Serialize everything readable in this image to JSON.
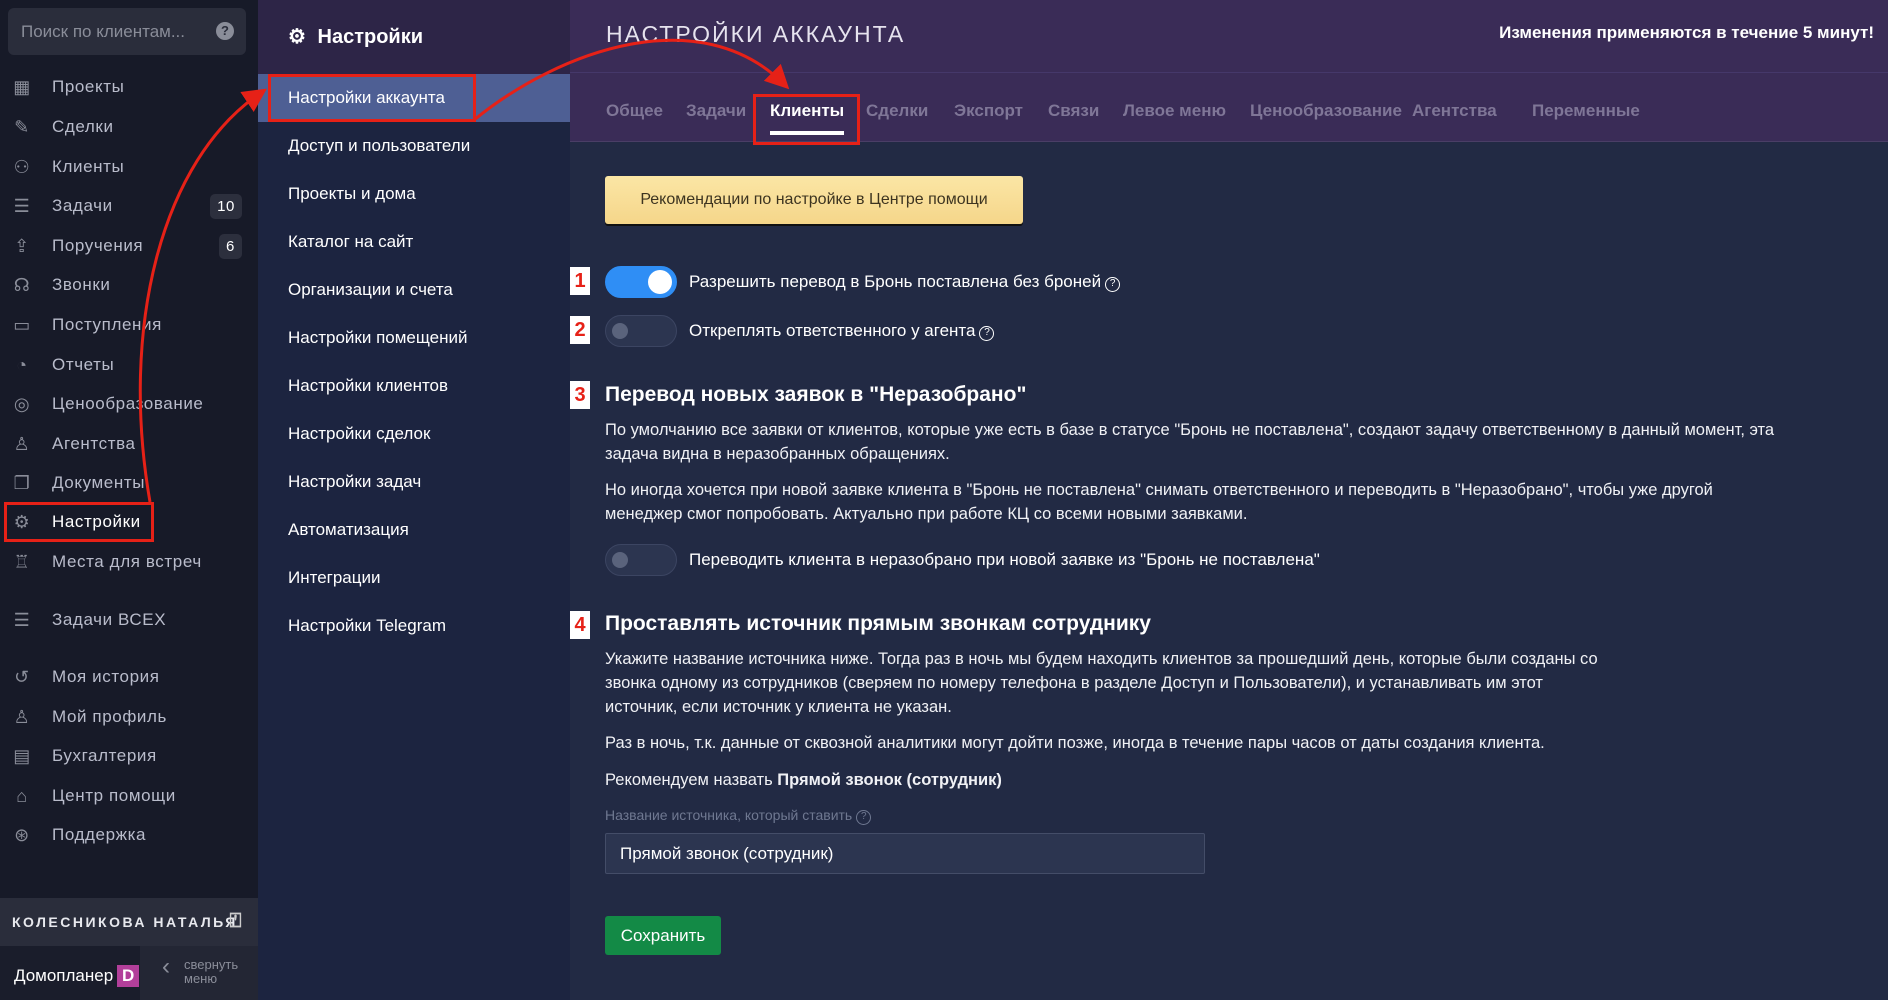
{
  "nav": {
    "search_placeholder": "Поиск по клиентам...",
    "help": "?",
    "items": [
      {
        "label": "Проекты",
        "icon": "building-icon"
      },
      {
        "label": "Сделки",
        "icon": "deal-icon"
      },
      {
        "label": "Клиенты",
        "icon": "users-icon"
      },
      {
        "label": "Задачи",
        "icon": "tasks-icon",
        "badge": "10"
      },
      {
        "label": "Поручения",
        "icon": "upload-icon",
        "badge": "6"
      },
      {
        "label": "Звонки",
        "icon": "headset-icon"
      },
      {
        "label": "Поступления",
        "icon": "wallet-icon"
      },
      {
        "label": "Отчеты",
        "icon": "pie-icon"
      },
      {
        "label": "Ценообразование",
        "icon": "coins-icon"
      },
      {
        "label": "Агентства",
        "icon": "agent-icon"
      },
      {
        "label": "Документы",
        "icon": "documents-icon"
      },
      {
        "label": "Настройки",
        "icon": "gear-icon"
      },
      {
        "label": "Места для встреч",
        "icon": "chair-icon"
      },
      {
        "label": "Задачи ВСЕХ",
        "icon": "tasks-icon"
      },
      {
        "label": "Моя история",
        "icon": "history-icon"
      },
      {
        "label": "Мой профиль",
        "icon": "profile-icon"
      },
      {
        "label": "Бухгалтерия",
        "icon": "card-icon"
      },
      {
        "label": "Центр помощи",
        "icon": "graduation-icon"
      },
      {
        "label": "Поддержка",
        "icon": "lifebuoy-icon"
      }
    ],
    "user": "КОЛЕСНИКОВА НАТАЛЬЯ",
    "brand": "Домопланер",
    "brand_logo": "D",
    "collapse": "свернуть меню"
  },
  "settings": {
    "title": "Настройки",
    "items": [
      "Настройки аккаунта",
      "Доступ и пользователи",
      "Проекты и дома",
      "Каталог на сайт",
      "Организации и счета",
      "Настройки помещений",
      "Настройки клиентов",
      "Настройки сделок",
      "Настройки задач",
      "Автоматизация",
      "Интеграции",
      "Настройки Telegram"
    ]
  },
  "main": {
    "title": "НАСТРОЙКИ АККАУНТА",
    "notice": "Изменения применяются в течение 5 минут!",
    "tabs": [
      "Общее",
      "Задачи",
      "Клиенты",
      "Сделки",
      "Экспорт",
      "Связи",
      "Левое меню",
      "Ценообразование",
      "Агентства",
      "Переменные"
    ],
    "help_button": "Рекомендации по настройке в Центре помощи",
    "annotations": [
      "1",
      "2",
      "3",
      "4"
    ],
    "toggle1": {
      "label": "Разрешить перевод в Бронь поставлена без броней",
      "on": true
    },
    "toggle2": {
      "label": "Откреплять ответственного у агента",
      "on": false
    },
    "s3": {
      "heading": "Перевод новых заявок в \"Неразобрано\"",
      "p1": "По умолчанию все заявки от клиентов, которые уже есть в базе в статусе \"Бронь не поставлена\", создают задачу ответственному в данный момент, эта задача видна в неразобранных обращениях.",
      "p2": "Но иногда хочется при новой заявке клиента в \"Бронь не поставлена\" снимать ответственного и переводить в \"Неразобрано\", чтобы уже другой менеджер смог попробовать. Актуально при работе КЦ со всеми новыми заявками.",
      "toggle": "Переводить клиента в неразобрано при новой заявке из \"Бронь не поставлена\"",
      "on": false
    },
    "s4": {
      "heading": "Проставлять источник прямым звонкам сотруднику",
      "p1": "Укажите название источника ниже. Тогда раз в ночь мы будем находить клиентов за прошедший день, которые были созданы со звонка одному из сотрудников (сверяем по номеру телефона в разделе Доступ и Пользователи), и устанавливать им этот источник, если источник у клиента не указан.",
      "p2": "Раз в ночь, т.к. данные от сквозной аналитики могут дойти позже, иногда в течение пары часов от даты создания клиента.",
      "rec_prefix": "Рекомендуем назвать ",
      "rec_bold": "Прямой звонок (сотрудник)",
      "field_label": "Название источника, который ставить",
      "field_value": "Прямой звонок (сотрудник)"
    },
    "save": "Сохранить"
  }
}
